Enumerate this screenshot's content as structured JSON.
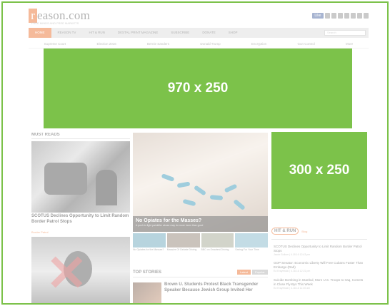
{
  "header": {
    "logo_initial": "r",
    "logo_rest": "eason.com",
    "tagline": "FREE MINDS AND FREE MARKETS",
    "like_label": "Like"
  },
  "nav": {
    "items": [
      "HOME",
      "REASON TV",
      "HIT & RUN",
      "DIGITAL PRINT MAGAZINE",
      "SUBSCRIBE",
      "DONATE",
      "SHOP"
    ],
    "search_placeholder": "Search"
  },
  "subnav": {
    "items": [
      "Supreme Court",
      "Election 2016",
      "Bernie Sanders",
      "Donald Trump",
      "Encryption",
      "Gun Control",
      "More"
    ]
  },
  "ads": {
    "top": "970 x 250",
    "side": "300 x 250"
  },
  "must_reads": {
    "label": "MUST READS",
    "headline": "SCOTUS Declines Opportunity to Limit Random Border Patrol Stops",
    "tag": "Border Patrol"
  },
  "feature": {
    "title": "No Opiates for the Masses?",
    "subtitle": "A push to fight painkiller abuse may do more harm than good"
  },
  "thumbs": [
    {
      "caption": "No Opiates for the Masses?"
    },
    {
      "caption": "Massive Of Debate Driving"
    },
    {
      "caption": "BBC on Smartest Driving"
    },
    {
      "caption": "Saving For Your Time"
    }
  ],
  "top_stories": {
    "label": "TOP STORIES",
    "tabs": [
      "Latest",
      "Popular"
    ],
    "headline": "Brown U. Students Protest Black Transgender Speaker Because Jewish Group Invited Her"
  },
  "hit_run": {
    "label": "HIT & RUN",
    "blog": "Blog",
    "items": [
      {
        "text": "SCOTUS Declines Opportunity to Limit Random Border Patrol Stops",
        "meta": "Jacob Sullum | 4.18.16 12:43 pm"
      },
      {
        "text": "GOP Senator: Economic Liberty Will Free Cubans Faster Than Embargo (Dah)",
        "meta": "Ed Krayewski | 4.18.16 12:21 pm"
      },
      {
        "text": "Suicide Bombing in Istanbul, More U.S. Troops to Iraq, Comets in Close Fly-Bys This Week",
        "meta": "Ed Krayewski | 4.18.16 11:40 am"
      }
    ]
  },
  "colors": {
    "brand": "#e8661e",
    "ad_placeholder": "#7cc24a"
  }
}
